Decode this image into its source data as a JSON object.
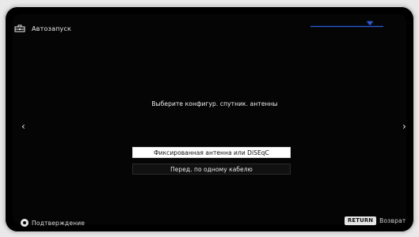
{
  "header": {
    "title": "Автозапуск",
    "icon": "toolbox-icon"
  },
  "prompt": {
    "text": "Выберите конфигур. спутник. антенны"
  },
  "options": [
    {
      "label": "Фиксированная антенна или DiSEqC",
      "selected": true
    },
    {
      "label": "Перед. по одному кабелю",
      "selected": false
    }
  ],
  "navigation": {
    "left_arrow": "‹",
    "right_arrow": "›"
  },
  "footer": {
    "confirm_label": "Подтверждение",
    "return_key": "RETURN",
    "return_label": "Возврат"
  },
  "colors": {
    "accent_blue": "#2d5bd6",
    "background": "#050505",
    "text": "#f0f0f0"
  }
}
